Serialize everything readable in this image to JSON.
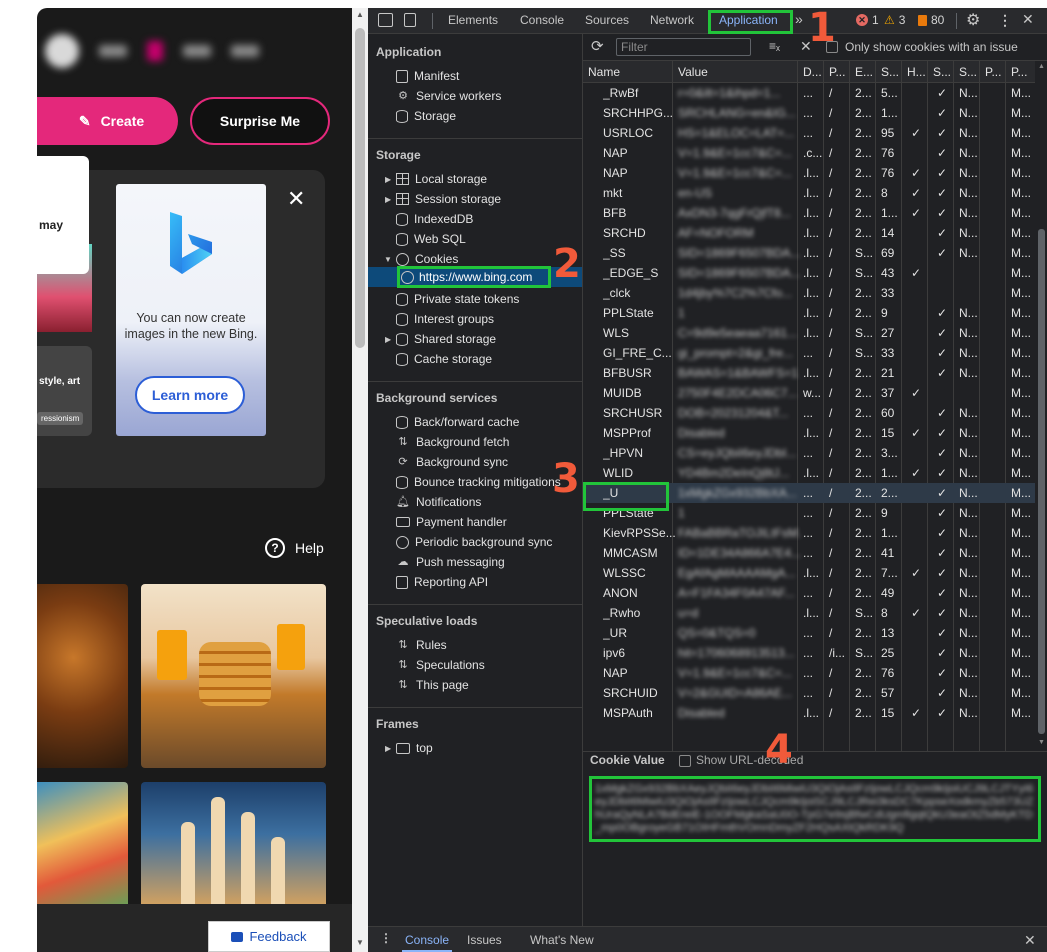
{
  "bing": {
    "create_label": "Create",
    "surprise_label": "Surprise Me",
    "tooltip_text": "may",
    "card_text": "style, art",
    "card_chip": "ressionism",
    "promo_text_line1": "You can now create",
    "promo_text_line2": "images in the new Bing.",
    "learn_more_label": "Learn more",
    "help_label": "Help",
    "feedback_label": "Feedback"
  },
  "devtools": {
    "tabs": [
      "Elements",
      "Console",
      "Sources",
      "Network",
      "Application"
    ],
    "active_tab": "Application",
    "more_tabs": "»",
    "errors": "1",
    "warnings": "3",
    "issues": "80",
    "sidebar": {
      "application": {
        "title": "Application",
        "items": [
          "Manifest",
          "Service workers",
          "Storage"
        ]
      },
      "storage": {
        "title": "Storage",
        "items": [
          "Local storage",
          "Session storage",
          "IndexedDB",
          "Web SQL",
          "Cookies",
          "Private state tokens",
          "Interest groups",
          "Shared storage",
          "Cache storage"
        ],
        "cookie_url": "https://www.bing.com"
      },
      "background_services": {
        "title": "Background services",
        "items": [
          "Back/forward cache",
          "Background fetch",
          "Background sync",
          "Bounce tracking mitigations",
          "Notifications",
          "Payment handler",
          "Periodic background sync",
          "Push messaging",
          "Reporting API"
        ]
      },
      "speculative_loads": {
        "title": "Speculative loads",
        "items": [
          "Rules",
          "Speculations",
          "This page"
        ]
      },
      "frames": {
        "title": "Frames",
        "items": [
          "top"
        ]
      }
    },
    "cookies_toolbar": {
      "filter_placeholder": "Filter",
      "only_issues_label": "Only show cookies with an issue"
    },
    "columns": [
      "Name",
      "Value",
      "D...",
      "P...",
      "E...",
      "S...",
      "H...",
      "S...",
      "S...",
      "P...",
      "P..."
    ],
    "rows": [
      {
        "name": "_RwBf",
        "value": "r=0&ilt=1&ihpd=1...",
        "d": "...",
        "p": "/",
        "e": "2...",
        "s": "5...",
        "h": "",
        "sec": "✓",
        "ss": "N...",
        "pa": "",
        "pr": "M..."
      },
      {
        "name": "SRCHHPG...",
        "value": "SRCHLANG=en&IG...",
        "d": "...",
        "p": "/",
        "e": "2...",
        "s": "1...",
        "h": "",
        "sec": "✓",
        "ss": "N...",
        "pa": "",
        "pr": "M..."
      },
      {
        "name": "USRLOC",
        "value": "HS=1&ELOC=LAT=...",
        "d": "...",
        "p": "/",
        "e": "2...",
        "s": "95",
        "h": "✓",
        "sec": "✓",
        "ss": "N...",
        "pa": "",
        "pr": "M..."
      },
      {
        "name": "NAP",
        "value": "V=1.9&E=1cc7&C=...",
        "d": ".c...",
        "p": "/",
        "e": "2...",
        "s": "76",
        "h": "",
        "sec": "✓",
        "ss": "N...",
        "pa": "",
        "pr": "M..."
      },
      {
        "name": "NAP",
        "value": "V=1.9&E=1cc7&C=...",
        "d": ".l...",
        "p": "/",
        "e": "2...",
        "s": "76",
        "h": "✓",
        "sec": "✓",
        "ss": "N...",
        "pa": "",
        "pr": "M..."
      },
      {
        "name": "mkt",
        "value": "en-US",
        "d": ".l...",
        "p": "/",
        "e": "2...",
        "s": "8",
        "h": "✓",
        "sec": "✓",
        "ss": "N...",
        "pa": "",
        "pr": "M..."
      },
      {
        "name": "BFB",
        "value": "AxDN3-7qgFrQjfT8...",
        "d": ".l...",
        "p": "/",
        "e": "2...",
        "s": "1...",
        "h": "✓",
        "sec": "✓",
        "ss": "N...",
        "pa": "",
        "pr": "M..."
      },
      {
        "name": "SRCHD",
        "value": "AF=NOFORM",
        "d": ".l...",
        "p": "/",
        "e": "2...",
        "s": "14",
        "h": "",
        "sec": "✓",
        "ss": "N...",
        "pa": "",
        "pr": "M..."
      },
      {
        "name": "_SS",
        "value": "SID=1869F6507BDA...",
        "d": ".l...",
        "p": "/",
        "e": "S...",
        "s": "69",
        "h": "",
        "sec": "✓",
        "ss": "N...",
        "pa": "",
        "pr": "M..."
      },
      {
        "name": "_EDGE_S",
        "value": "SID=1869F6507BDA...",
        "d": ".l...",
        "p": "/",
        "e": "S...",
        "s": "43",
        "h": "✓",
        "sec": "",
        "ss": "",
        "pa": "",
        "pr": "M..."
      },
      {
        "name": "_clck",
        "value": "1d4jby%7C2%7Cfo...",
        "d": ".l...",
        "p": "/",
        "e": "2...",
        "s": "33",
        "h": "",
        "sec": "",
        "ss": "",
        "pa": "",
        "pr": "M..."
      },
      {
        "name": "PPLState",
        "value": "1",
        "d": ".l...",
        "p": "/",
        "e": "2...",
        "s": "9",
        "h": "",
        "sec": "✓",
        "ss": "N...",
        "pa": "",
        "pr": "M..."
      },
      {
        "name": "WLS",
        "value": "C=9d9e5eaeaa7161...",
        "d": ".l...",
        "p": "/",
        "e": "S...",
        "s": "27",
        "h": "",
        "sec": "✓",
        "ss": "N...",
        "pa": "",
        "pr": "M..."
      },
      {
        "name": "GI_FRE_C...",
        "value": "gi_prompt=2&gi_fre...",
        "d": "...",
        "p": "/",
        "e": "S...",
        "s": "33",
        "h": "",
        "sec": "✓",
        "ss": "N...",
        "pa": "",
        "pr": "M..."
      },
      {
        "name": "BFBUSR",
        "value": "BAWAS=1&BAWFS=1",
        "d": ".l...",
        "p": "/",
        "e": "2...",
        "s": "21",
        "h": "",
        "sec": "✓",
        "ss": "N...",
        "pa": "",
        "pr": "M..."
      },
      {
        "name": "MUIDB",
        "value": "2750F4E2DCA06C7...",
        "d": "w...",
        "p": "/",
        "e": "2...",
        "s": "37",
        "h": "✓",
        "sec": "",
        "ss": "",
        "pa": "",
        "pr": "M..."
      },
      {
        "name": "SRCHUSR",
        "value": "DOB=20231204&T...",
        "d": "...",
        "p": "/",
        "e": "2...",
        "s": "60",
        "h": "",
        "sec": "✓",
        "ss": "N...",
        "pa": "",
        "pr": "M..."
      },
      {
        "name": "MSPProf",
        "value": "Disabled",
        "d": ".l...",
        "p": "/",
        "e": "2...",
        "s": "15",
        "h": "✓",
        "sec": "✓",
        "ss": "N...",
        "pa": "",
        "pr": "M..."
      },
      {
        "name": "_HPVN",
        "value": "CS=eyJQbiI6eyJDbI...",
        "d": "...",
        "p": "/",
        "e": "2...",
        "s": "3...",
        "h": "",
        "sec": "✓",
        "ss": "N...",
        "pa": "",
        "pr": "M..."
      },
      {
        "name": "WLID",
        "value": "YD4Bm2DeInQj8tJ...",
        "d": ".l...",
        "p": "/",
        "e": "2...",
        "s": "1...",
        "h": "✓",
        "sec": "✓",
        "ss": "N...",
        "pa": "",
        "pr": "M..."
      },
      {
        "name": "_U",
        "value": "1xMgkZGx932BbXA...",
        "d": "...",
        "p": "/",
        "e": "2...",
        "s": "2...",
        "h": "",
        "sec": "✓",
        "ss": "N...",
        "pa": "",
        "pr": "M...",
        "selected": true
      },
      {
        "name": "PPLState",
        "value": "1",
        "d": "...",
        "p": "/",
        "e": "2...",
        "s": "9",
        "h": "",
        "sec": "✓",
        "ss": "N...",
        "pa": "",
        "pr": "M..."
      },
      {
        "name": "KievRPSSe...",
        "value": "FABaBBRaTOJILtFsM...",
        "d": "...",
        "p": "/",
        "e": "2...",
        "s": "1...",
        "h": "",
        "sec": "✓",
        "ss": "N...",
        "pa": "",
        "pr": "M..."
      },
      {
        "name": "MMCASM",
        "value": "ID=1DE34A866A7E4...",
        "d": "...",
        "p": "/",
        "e": "2...",
        "s": "41",
        "h": "",
        "sec": "✓",
        "ss": "N...",
        "pa": "",
        "pr": "M..."
      },
      {
        "name": "WLSSC",
        "value": "EgAfAgMAAAAMgA...",
        "d": ".l...",
        "p": "/",
        "e": "2...",
        "s": "7...",
        "h": "✓",
        "sec": "✓",
        "ss": "N...",
        "pa": "",
        "pr": "M..."
      },
      {
        "name": "ANON",
        "value": "A=F1FA34F0A47AF...",
        "d": "...",
        "p": "/",
        "e": "2...",
        "s": "49",
        "h": "",
        "sec": "✓",
        "ss": "N...",
        "pa": "",
        "pr": "M..."
      },
      {
        "name": "_Rwho",
        "value": "u=d",
        "d": ".l...",
        "p": "/",
        "e": "S...",
        "s": "8",
        "h": "✓",
        "sec": "✓",
        "ss": "N...",
        "pa": "",
        "pr": "M..."
      },
      {
        "name": "_UR",
        "value": "QS=0&TQS=0",
        "d": "...",
        "p": "/",
        "e": "2...",
        "s": "13",
        "h": "",
        "sec": "✓",
        "ss": "N...",
        "pa": "",
        "pr": "M..."
      },
      {
        "name": "ipv6",
        "value": "hit=1706068913513...",
        "d": "...",
        "p": "/i...",
        "e": "S...",
        "s": "25",
        "h": "",
        "sec": "✓",
        "ss": "N...",
        "pa": "",
        "pr": "M..."
      },
      {
        "name": "NAP",
        "value": "V=1.9&E=1cc7&C=...",
        "d": "...",
        "p": "/",
        "e": "2...",
        "s": "76",
        "h": "",
        "sec": "✓",
        "ss": "N...",
        "pa": "",
        "pr": "M..."
      },
      {
        "name": "SRCHUID",
        "value": "V=2&GUID=A86AE...",
        "d": "...",
        "p": "/",
        "e": "2...",
        "s": "57",
        "h": "",
        "sec": "✓",
        "ss": "N...",
        "pa": "",
        "pr": "M..."
      },
      {
        "name": "MSPAuth",
        "value": "Disabled",
        "d": ".l...",
        "p": "/",
        "e": "2...",
        "s": "15",
        "h": "✓",
        "sec": "✓",
        "ss": "N...",
        "pa": "",
        "pr": "M..."
      }
    ],
    "cookie_value_title": "Cookie Value",
    "show_url_decoded_label": "Show URL-decoded",
    "cookie_value_text": "1xMgkZGx932BbXAeyJQbiI6eyJDbiI6MiwiU3QiOjAsIlFzIjowLCJQcm9kIjoiUCJ9LCJTYyI6eyJDbiI6MiwiU3QiOjAsIlFzIjowLCJQcm9kIjoiSCJ9LCJRei3ksDC7KppseXodkmyZb573UZhUraQyNLA7BdEreiE-1OOFMgkaSaU0O-TpG7e9sjBfwCdUgmfigqtQkU3eaOtZ5dMyKTD_mp0OBgroyeGB71OIHFmthVOmnDmyZF2HQsAXtQkRDK9Q",
    "drawer_tabs": [
      "Console",
      "Issues",
      "What's New"
    ]
  },
  "annotations": [
    "1",
    "2",
    "3",
    "4"
  ],
  "colors": {
    "annotation_box": "#22c43a",
    "annotation_number": "#f15a3a",
    "bing_pink": "#e4287b",
    "devtools_accent": "#8ab4f8"
  }
}
